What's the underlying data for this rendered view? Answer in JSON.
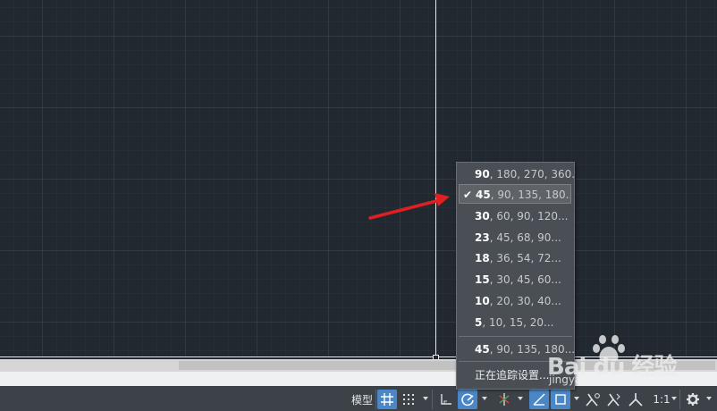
{
  "statusbar": {
    "model_label": "模型",
    "scale_label": "1:1"
  },
  "tracking_menu": {
    "items": [
      {
        "bold": "90",
        "rest": ", 180, 270, 360...",
        "checked": false
      },
      {
        "bold": "45",
        "rest": ", 90, 135, 180...",
        "checked": true
      },
      {
        "bold": "30",
        "rest": ", 60, 90, 120...",
        "checked": false
      },
      {
        "bold": "23",
        "rest": ", 45, 68, 90...",
        "checked": false
      },
      {
        "bold": "18",
        "rest": ", 36, 54, 72...",
        "checked": false
      },
      {
        "bold": "15",
        "rest": ", 30, 45, 60...",
        "checked": false
      },
      {
        "bold": "10",
        "rest": ", 20, 30, 40...",
        "checked": false
      },
      {
        "bold": "5",
        "rest": ", 10, 15, 20...",
        "checked": false
      }
    ],
    "recent": {
      "bold": "45",
      "rest": ", 90, 135, 180..."
    },
    "settings_label": "正在追踪设置...",
    "check_glyph": "✔"
  },
  "watermark": {
    "brand": "Bai du 经验",
    "url": "jingyan.baidu.com"
  },
  "colors": {
    "canvas": "#212830",
    "accent": "#4b87c7",
    "arrow": "#e02020"
  }
}
